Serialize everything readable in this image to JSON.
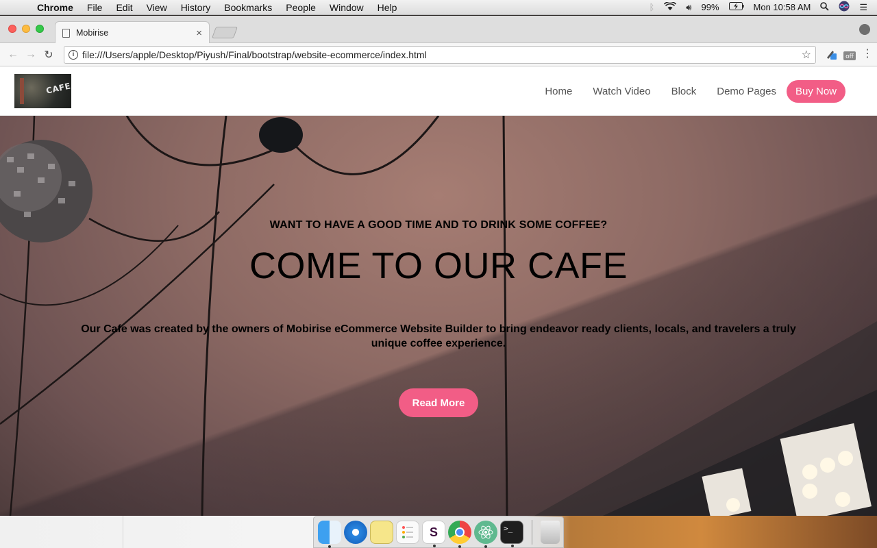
{
  "menubar": {
    "app": "Chrome",
    "items": [
      "File",
      "Edit",
      "View",
      "History",
      "Bookmarks",
      "People",
      "Window",
      "Help"
    ],
    "battery": "99%",
    "clock": "Mon 10:58 AM"
  },
  "browser": {
    "tab_title": "Mobirise",
    "url": "file:///Users/apple/Desktop/Piyush/Final/bootstrap/website-ecommerce/index.html",
    "extension_badge": "off"
  },
  "site": {
    "logo_text": "CAFE",
    "nav": [
      "Home",
      "Watch Video",
      "Block",
      "Demo Pages"
    ],
    "cta": "Buy Now"
  },
  "hero": {
    "kicker": "WANT TO HAVE A GOOD TIME AND TO DRINK SOME COFFEE?",
    "headline": "COME TO OUR CAFE",
    "description": "Our Cafe was created by the owners of Mobirise eCommerce Website Builder to bring endeavor ready clients, locals, and travelers a truly unique coffee experience.",
    "button": "Read More"
  },
  "colors": {
    "accent": "#f25d86"
  },
  "dock": {
    "icons": [
      "finder-icon",
      "safari-icon",
      "notes-icon",
      "reminders-icon",
      "slack-icon",
      "chrome-icon",
      "atom-icon",
      "terminal-icon",
      "trash-icon"
    ]
  }
}
